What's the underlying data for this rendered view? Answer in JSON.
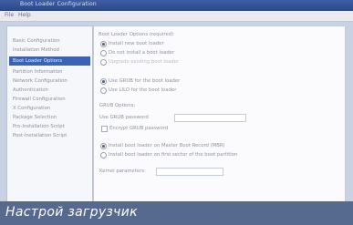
{
  "window": {
    "title": "Boot Loader Configuration"
  },
  "menu": {
    "items": [
      "File",
      "Help"
    ]
  },
  "sidebar": {
    "items": [
      {
        "label": "Basic Configuration"
      },
      {
        "label": "Installation Method"
      },
      {
        "label": "Boot Loader Options",
        "active": true
      },
      {
        "label": "Partition Information"
      },
      {
        "label": "Network Configuration"
      },
      {
        "label": "Authentication"
      },
      {
        "label": "Firewall Configuration"
      },
      {
        "label": "X Configuration"
      },
      {
        "label": "Package Selection"
      },
      {
        "label": "Pre-Installation Script"
      },
      {
        "label": "Post-Installation Script"
      }
    ]
  },
  "main": {
    "header": "Boot Loader Options (required)",
    "install_type": {
      "options": [
        {
          "label": "Install new boot loader",
          "selected": true
        },
        {
          "label": "Do not install a boot loader",
          "selected": false
        },
        {
          "label": "Upgrade existing boot loader",
          "selected": false
        }
      ]
    },
    "loader": {
      "options": [
        {
          "label": "Use GRUB for the boot loader",
          "selected": true
        },
        {
          "label": "Use LILO for the boot loader",
          "selected": false
        }
      ]
    },
    "grub_options": {
      "section_label": "GRUB Options:",
      "password_label": "Use GRUB password",
      "password_value": "",
      "encrypt_label": "Encrypt GRUB password"
    },
    "install_location": {
      "options": [
        {
          "label": "Install boot loader on Master Boot Record (MBR)",
          "selected": true
        },
        {
          "label": "Install boot loader on first sector of the boot partition",
          "selected": false
        }
      ]
    },
    "kernel_params": {
      "label": "Kernel parameters:",
      "value": ""
    }
  },
  "caption": {
    "text": "Настрой загрузчик"
  }
}
